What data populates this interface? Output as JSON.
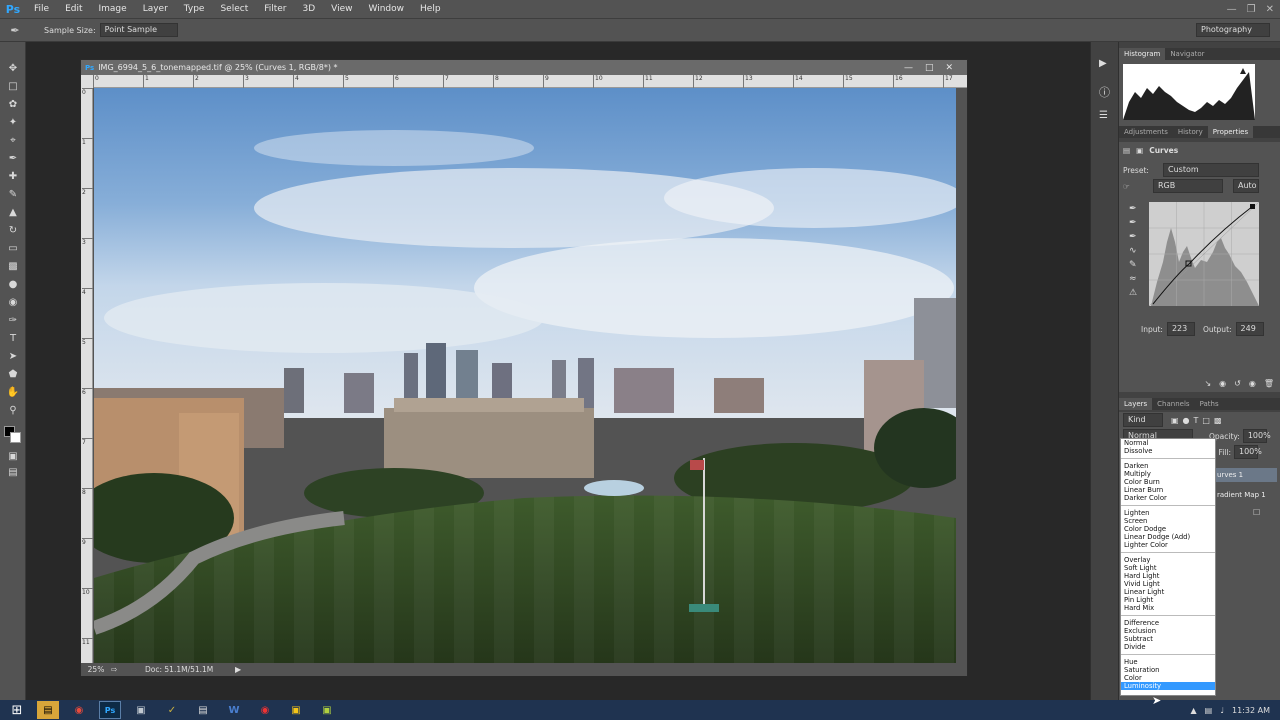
{
  "menubar": {
    "logo": "Ps",
    "items": [
      "File",
      "Edit",
      "Image",
      "Layer",
      "Type",
      "Select",
      "Filter",
      "3D",
      "View",
      "Window",
      "Help"
    ]
  },
  "options": {
    "sample_size_label": "Sample Size:",
    "sample_size_value": "Point Sample",
    "workspace": "Photography"
  },
  "document": {
    "title": "IMG_6994_5_6_tonemapped.tif @ 25% (Curves 1, RGB/8*) *",
    "zoom": "25%",
    "doc_info": "Doc: 51.1M/51.1M",
    "ruler_top": [
      "0",
      "1",
      "2",
      "3",
      "4",
      "5",
      "6",
      "7",
      "8",
      "9",
      "10",
      "11",
      "12",
      "13",
      "14",
      "15",
      "16",
      "17"
    ],
    "ruler_left": [
      "0",
      "1",
      "2",
      "3",
      "4",
      "5",
      "6",
      "7",
      "8",
      "9",
      "10",
      "11"
    ]
  },
  "panels": {
    "top_tabs": [
      "Histogram",
      "Navigator"
    ],
    "mid_tabs": [
      "Adjustments",
      "History",
      "Properties"
    ],
    "properties_title": "Curves",
    "preset_label": "Preset:",
    "preset_value": "Custom",
    "channel_value": "RGB",
    "auto_label": "Auto",
    "input_label": "Input:",
    "input_value": "223",
    "output_label": "Output:",
    "output_value": "249",
    "layer_tabs": [
      "Layers",
      "Channels",
      "Paths"
    ],
    "kind_label": "Kind",
    "blend_value": "Normal",
    "opacity_label": "Opacity:",
    "opacity_value": "100%",
    "fill_label": "Fill:",
    "fill_value": "100%",
    "layer_names": [
      "urves 1",
      "radient Map 1"
    ]
  },
  "blend_modes": {
    "groups": [
      [
        "Normal",
        "Dissolve"
      ],
      [
        "Darken",
        "Multiply",
        "Color Burn",
        "Linear Burn",
        "Darker Color"
      ],
      [
        "Lighten",
        "Screen",
        "Color Dodge",
        "Linear Dodge (Add)",
        "Lighter Color"
      ],
      [
        "Overlay",
        "Soft Light",
        "Hard Light",
        "Vivid Light",
        "Linear Light",
        "Pin Light",
        "Hard Mix"
      ],
      [
        "Difference",
        "Exclusion",
        "Subtract",
        "Divide"
      ],
      [
        "Hue",
        "Saturation",
        "Color",
        "Luminosity"
      ]
    ],
    "selected": "Luminosity"
  },
  "taskbar": {
    "clock": "11:32 AM"
  },
  "colors": {
    "ui_dark": "#282828",
    "ui_panel": "#535353",
    "accent": "#31a8ff",
    "menu_select": "#3399ff",
    "taskbar": "#1f3350"
  }
}
